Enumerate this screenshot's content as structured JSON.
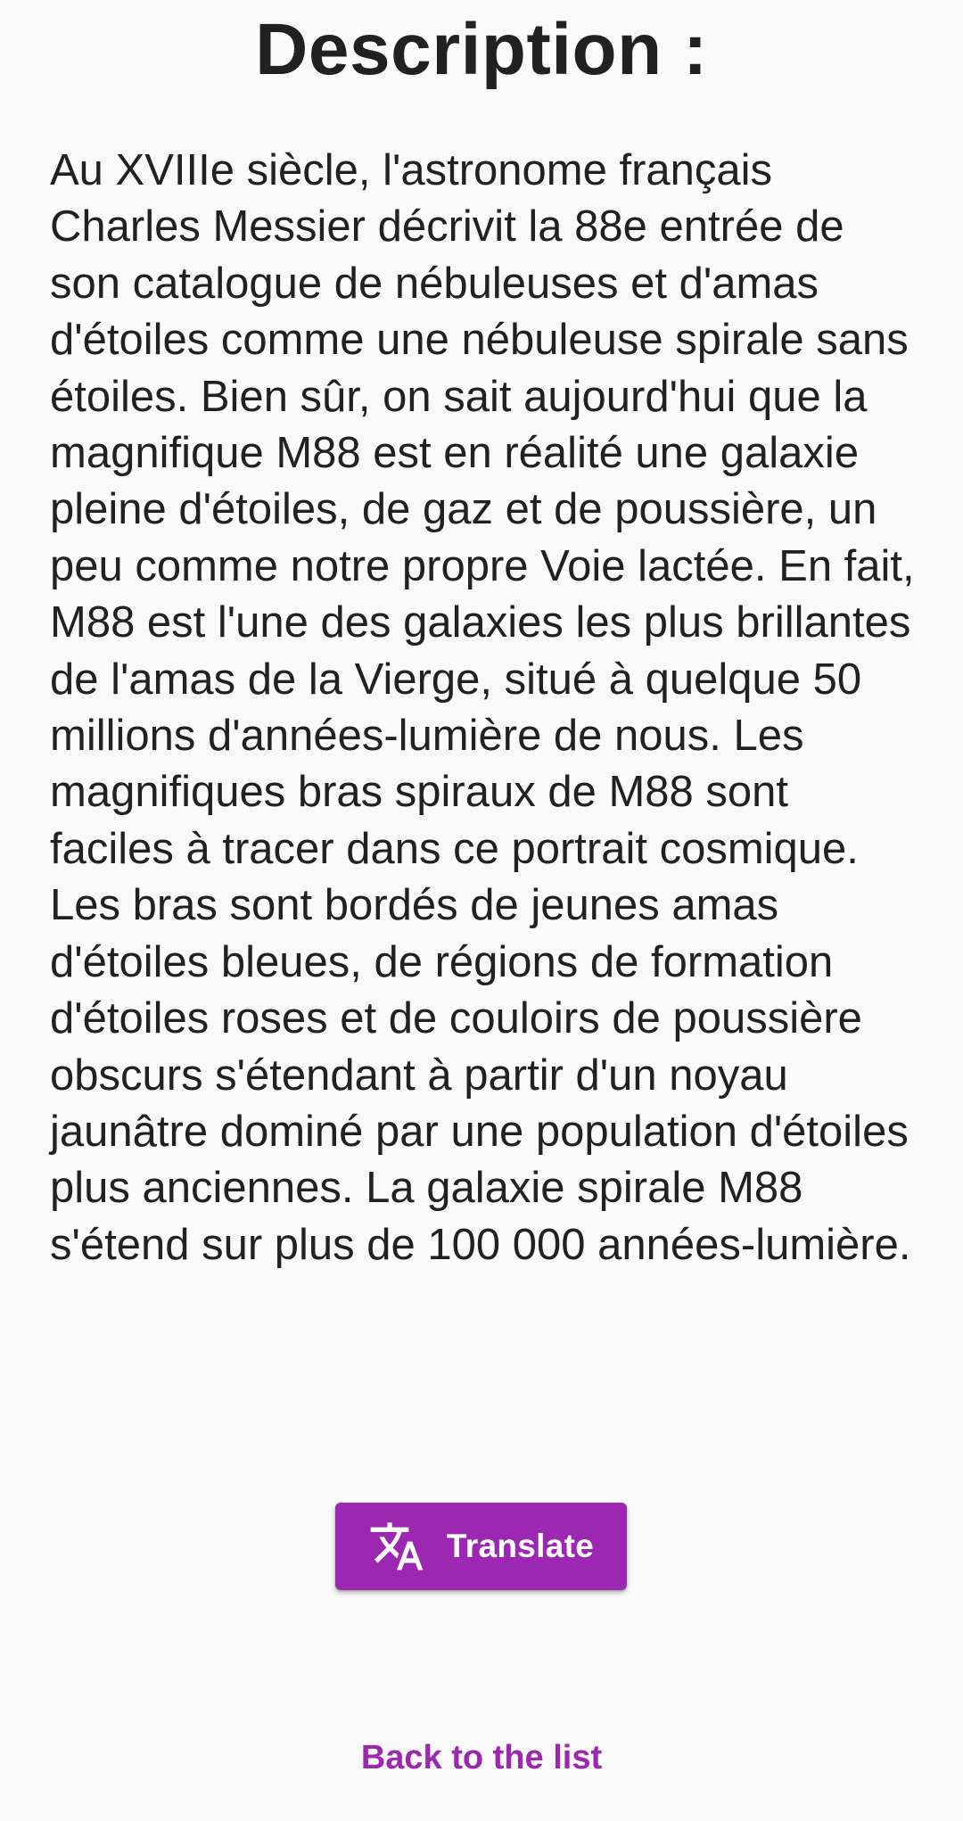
{
  "page": {
    "title": "Description :",
    "description": "Au XVIIIe siècle, l'astronome français Charles Messier décrivit la 88e entrée de son catalogue de nébuleuses et d'amas d'étoiles comme une nébuleuse spirale sans étoiles. Bien sûr, on sait aujourd'hui que la magnifique M88 est en réalité une galaxie pleine d'étoiles, de gaz et de poussière, un peu comme notre propre Voie lactée. En fait, M88 est l'une des galaxies les plus brillantes de l'amas de la Vierge, situé à quelque 50 millions d'années-lumière de nous. Les magnifiques bras spiraux de M88 sont faciles à tracer dans ce portrait cosmique. Les bras sont bordés de jeunes amas d'étoiles bleues, de régions de formation d'étoiles roses et de couloirs de poussière obscurs s'étendant à partir d'un noyau jaunâtre dominé par une population d'étoiles plus anciennes. La galaxie spirale M88 s'étend sur plus de 100 000 années-lumière."
  },
  "actions": {
    "translate_label": "Translate",
    "translate_icon": "translate-icon",
    "back_label": "Back to the list"
  },
  "colors": {
    "accent": "#9c27b0",
    "background": "#fafafa",
    "text": "#212121"
  }
}
